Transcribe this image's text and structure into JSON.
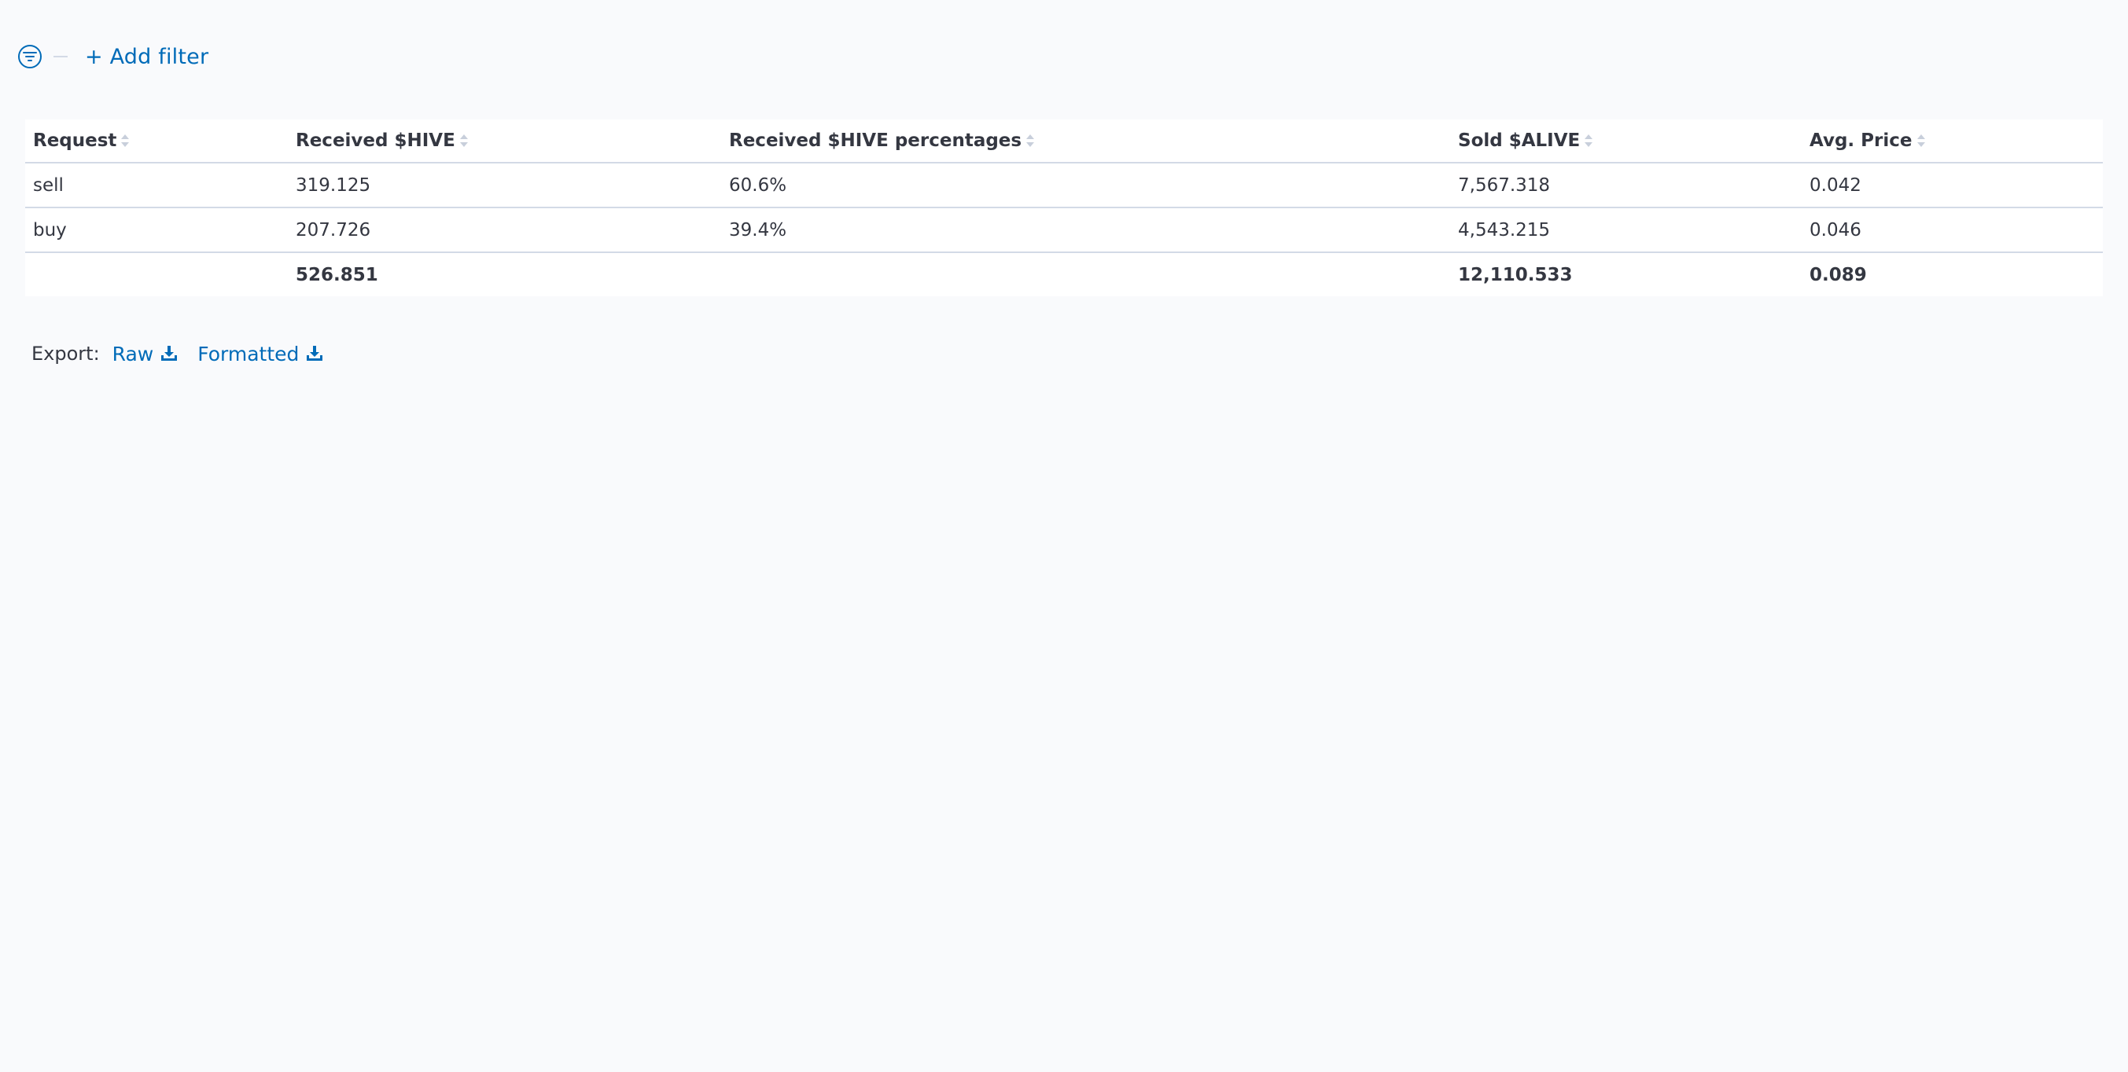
{
  "filter_bar": {
    "add_filter_label": "+ Add filter"
  },
  "table": {
    "columns": [
      "Request",
      "Received $HIVE",
      "Received $HIVE percentages",
      "Sold $ALIVE",
      "Avg. Price"
    ],
    "rows": [
      [
        "sell",
        "319.125",
        "60.6%",
        "7,567.318",
        "0.042"
      ],
      [
        "buy",
        "207.726",
        "39.4%",
        "4,543.215",
        "0.046"
      ]
    ],
    "totals": [
      "",
      "526.851",
      "",
      "12,110.533",
      "0.089"
    ]
  },
  "export": {
    "label": "Export:",
    "raw_label": "Raw",
    "formatted_label": "Formatted"
  },
  "colors": {
    "link": "#006bb8",
    "text": "#343741",
    "border": "#d3dae6",
    "background": "#f9fafc"
  },
  "icons": {
    "filter": "filter-circle-icon",
    "sort": "sort-icon",
    "download": "download-icon"
  }
}
